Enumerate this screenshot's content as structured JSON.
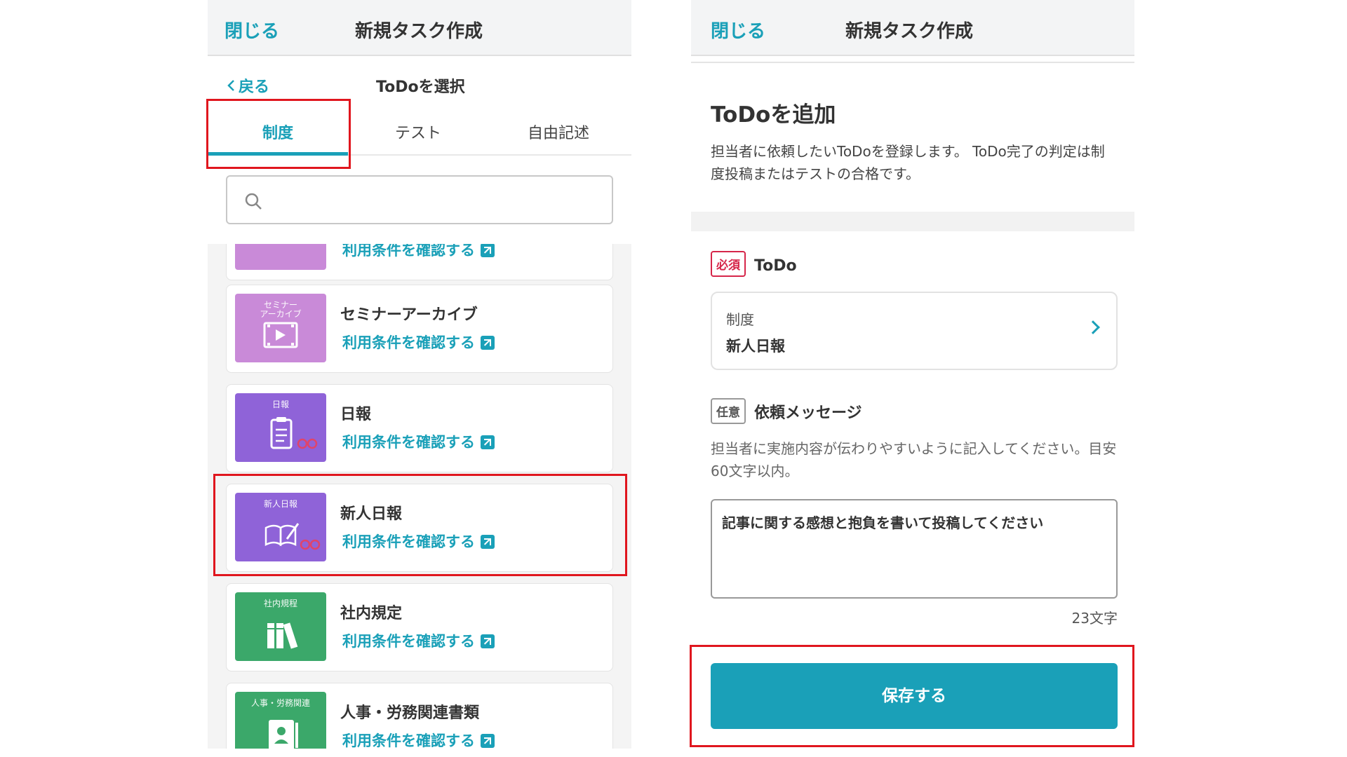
{
  "left_panel": {
    "header": {
      "close_label": "閉じる",
      "title": "新規タスク作成"
    },
    "back_label": "戻る",
    "subtitle": "ToDoを選択",
    "tabs": [
      {
        "label": "制度",
        "active": true
      },
      {
        "label": "テスト",
        "active": false
      },
      {
        "label": "自由記述",
        "active": false
      }
    ],
    "search": {
      "placeholder": "",
      "icon": "search-icon"
    },
    "items": [
      {
        "title": "",
        "link": "利用条件を確認する",
        "thumb_label": "",
        "thumb_color": "#c98ad8"
      },
      {
        "title": "セミナーアーカイブ",
        "link": "利用条件を確認する",
        "thumb_label": "セミナー\nアーカイブ",
        "thumb_color": "#c98ad8"
      },
      {
        "title": "日報",
        "link": "利用条件を確認する",
        "thumb_label": "日報",
        "thumb_color": "#8f63d8"
      },
      {
        "title": "新人日報",
        "link": "利用条件を確認する",
        "thumb_label": "新人日報",
        "thumb_color": "#8f63d8"
      },
      {
        "title": "社内規定",
        "link": "利用条件を確認する",
        "thumb_label": "社内規程",
        "thumb_color": "#3ba86a"
      },
      {
        "title": "人事・労務関連書類",
        "link": "利用条件を確認する",
        "thumb_label": "人事・労務関連",
        "thumb_color": "#3ba86a"
      }
    ]
  },
  "right_panel": {
    "header": {
      "close_label": "閉じる",
      "title": "新規タスク作成"
    },
    "heading": "ToDoを追加",
    "description": "担当者に依頼したいToDoを登録します。 ToDo完了の判定は制度投稿またはテストの合格です。",
    "todo_field": {
      "badge": "必須",
      "label": "ToDo",
      "category": "制度",
      "value": "新人日報"
    },
    "message_field": {
      "badge": "任意",
      "label": "依頼メッセージ",
      "hint": "担当者に実施内容が伝わりやすいように記入してください。目安60文字以内。",
      "value": "記事に関する感想と抱負を書いて投稿してください",
      "count": "23文字"
    },
    "save_label": "保存する"
  },
  "colors": {
    "accent": "#1aa0b8",
    "highlight": "#e0161e",
    "required": "#d6264a"
  }
}
